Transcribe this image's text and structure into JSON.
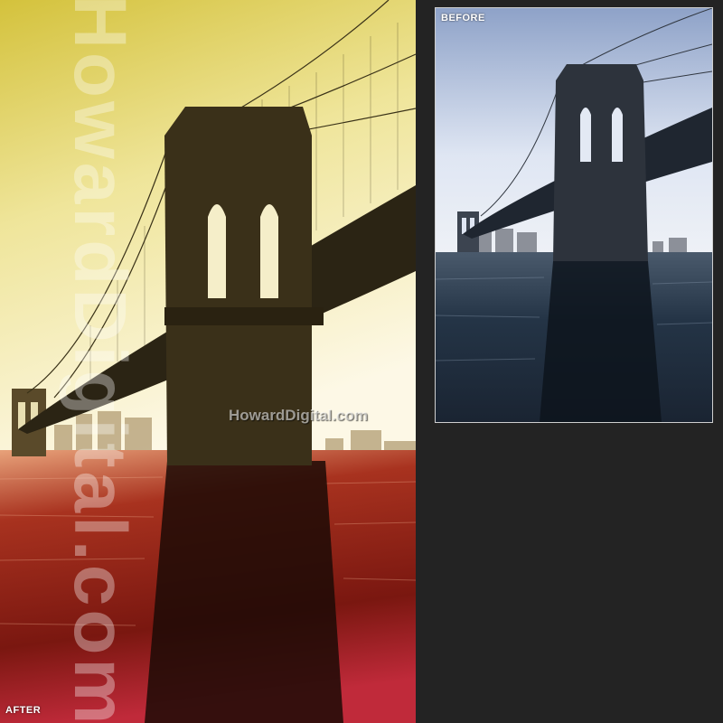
{
  "after_panel": {
    "label": "AFTER",
    "watermark_vertical": "HowardDigital.com",
    "watermark_center": "HowardDigital.com"
  },
  "before_panel": {
    "label": "BEFORE"
  },
  "colors": {
    "background": "#232323",
    "after_sky_top": "#d9c94a",
    "after_sky_bottom": "#fbf4d9",
    "after_water": "#b02a1a",
    "before_sky": "#dfe7f5",
    "before_water": "#1f2f40"
  }
}
